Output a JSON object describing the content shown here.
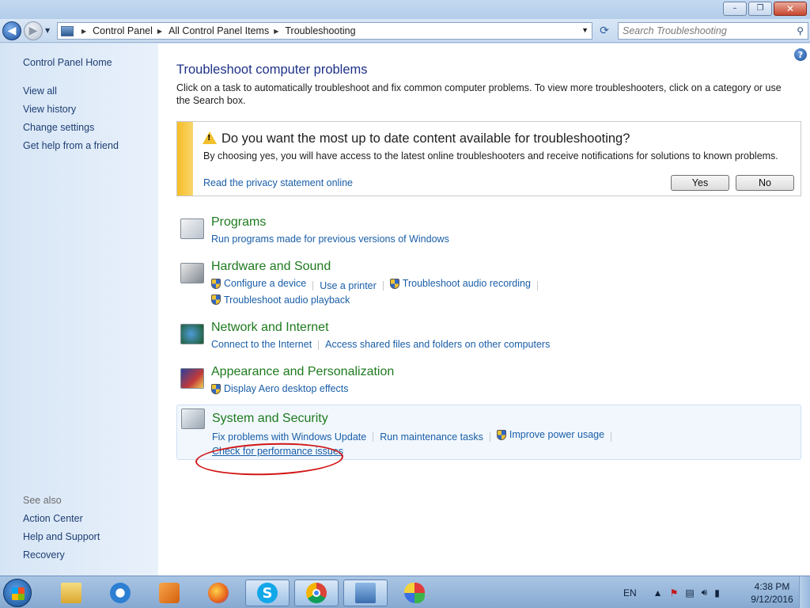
{
  "window": {
    "controls": {
      "minimize": "–",
      "restore": "❐",
      "close": "✕"
    }
  },
  "address_bar": {
    "breadcrumb": [
      "Control Panel",
      "All Control Panel Items",
      "Troubleshooting"
    ],
    "search_placeholder": "Search Troubleshooting"
  },
  "sidebar": {
    "top_links": [
      "Control Panel Home",
      "View all",
      "View history",
      "Change settings",
      "Get help from a friend"
    ],
    "see_also_label": "See also",
    "see_also_links": [
      "Action Center",
      "Help and Support",
      "Recovery"
    ]
  },
  "main": {
    "title": "Troubleshoot computer problems",
    "description": "Click on a task to automatically troubleshoot and fix common computer problems. To view more troubleshooters, click on a category or use the Search box.",
    "infobar": {
      "heading": "Do you want the most up to date content available for troubleshooting?",
      "body": "By choosing yes, you will have access to the latest online troubleshooters and receive notifications for solutions to known problems.",
      "privacy_link": "Read the privacy statement online",
      "yes_label": "Yes",
      "no_label": "No",
      "stripe_color": "#f5bd26"
    },
    "categories": [
      {
        "name": "Programs",
        "links": [
          "Run programs made for previous versions of Windows"
        ]
      },
      {
        "name": "Hardware and Sound",
        "links": [
          "Configure a device",
          "Use a printer",
          "Troubleshoot audio recording",
          "Troubleshoot audio playback"
        ]
      },
      {
        "name": "Network and Internet",
        "links": [
          "Connect to the Internet",
          "Access shared files and folders on other computers"
        ]
      },
      {
        "name": "Appearance and Personalization",
        "links": [
          "Display Aero desktop effects"
        ]
      },
      {
        "name": "System and Security",
        "links": [
          "Fix problems with Windows Update",
          "Run maintenance tasks",
          "Improve power usage",
          "Check for performance issues"
        ]
      }
    ],
    "link_color": "#1a5ea8",
    "category_color": "#1e7a1e"
  },
  "taskbar": {
    "apps": [
      "windows-explorer-icon",
      "internet-explorer-icon",
      "media-player-icon",
      "firefox-icon",
      "skype-icon",
      "chrome-icon",
      "control-panel-icon",
      "paint-icon"
    ],
    "language": "EN",
    "time": "4:38 PM",
    "date": "9/12/2016"
  }
}
